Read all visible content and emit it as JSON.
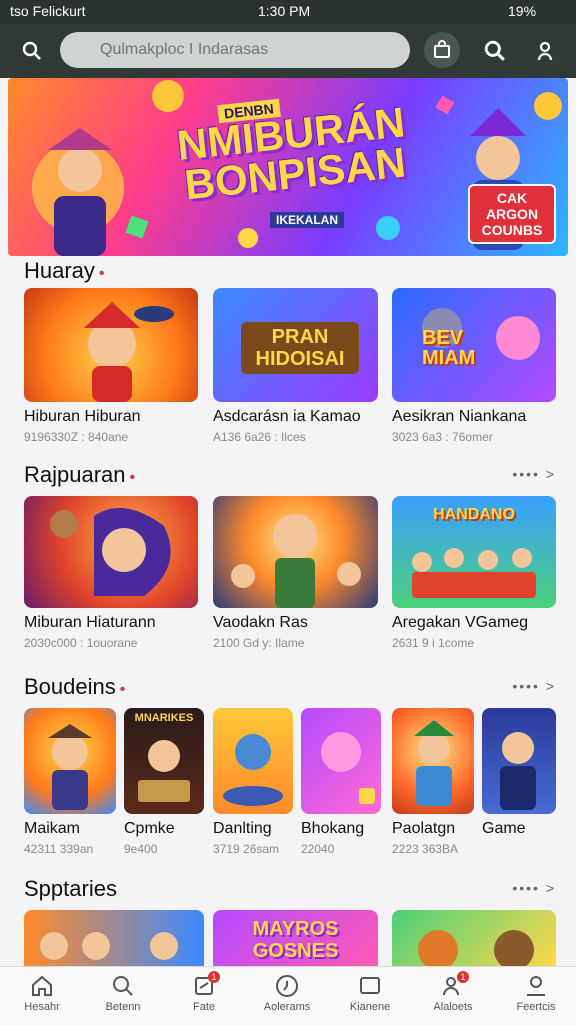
{
  "status_bar": {
    "carrier": "tso Felickurt",
    "time": "1:30 PM",
    "battery": "19%"
  },
  "header": {
    "search_placeholder": "Qulmakploc I Indarasas"
  },
  "banner": {
    "small_label": "DENBN",
    "title": "NMIBURÁN BONPISAN",
    "subtitle": "IKEKALAN",
    "tag": "CAK ARGON COUNBS"
  },
  "sections": [
    {
      "title": "Huaray",
      "more": "",
      "cards": [
        {
          "title": "Hiburan Hiburan",
          "meta": "9196330Z : 840ane",
          "thumb_text": ""
        },
        {
          "title": "Asdcarásn ia Kamao",
          "meta": "A136 6a26 : Ilces",
          "thumb_text": "PRAN HIDOISAI"
        },
        {
          "title": "Aesikran Niankana",
          "meta": "3023 6a3 : 76omer",
          "thumb_text": "BEV MIAM"
        }
      ]
    },
    {
      "title": "Rajpuaran",
      "more": "•••• >",
      "cards": [
        {
          "title": "Miburan Hiaturann",
          "meta": "2030c000 : 1ouorane",
          "thumb_text": ""
        },
        {
          "title": "Vaodakn Ras",
          "meta": "2100 Gd y: Ilame",
          "thumb_text": ""
        },
        {
          "title": "Aregakan VGameg",
          "meta": "2631 9 i 1come",
          "thumb_text": "HANDANO"
        }
      ]
    },
    {
      "title": "Boudeins",
      "more": "•••• >",
      "cards": [
        {
          "title": "Maikam",
          "meta": "42311 339an",
          "thumb_text": ""
        },
        {
          "title": "Cpmke",
          "meta": "9e400",
          "thumb_text": "MNARIKES"
        },
        {
          "title": "Danlting",
          "meta": "3719 26sam",
          "thumb_text": ""
        },
        {
          "title": "Bhokang",
          "meta": "22040",
          "thumb_text": ""
        },
        {
          "title": "Paolatgn",
          "meta": "2223 363BA",
          "thumb_text": ""
        },
        {
          "title": "Game",
          "meta": "",
          "thumb_text": ""
        }
      ]
    },
    {
      "title": "Spptaries",
      "more": "•••• >",
      "cards": [
        {
          "title": "",
          "meta": "",
          "thumb_text": ""
        },
        {
          "title": "",
          "meta": "",
          "thumb_text": "MAYROS GOSNES"
        },
        {
          "title": "",
          "meta": "",
          "thumb_text": ""
        }
      ]
    }
  ],
  "bottom_nav": [
    {
      "label": "Hesahr",
      "icon": "home-icon"
    },
    {
      "label": "Betenn",
      "icon": "search-icon"
    },
    {
      "label": "Fate",
      "icon": "tag-icon",
      "badge": "1"
    },
    {
      "label": "Aolerams",
      "icon": "clock-icon"
    },
    {
      "label": "Kianene",
      "icon": "square-icon"
    },
    {
      "label": "Alaloets",
      "icon": "people-icon",
      "badge": "1"
    },
    {
      "label": "Feertcis",
      "icon": "person-icon"
    }
  ],
  "colors": {
    "header": "#2f3a36",
    "accent": "#e03030",
    "background": "#f4f4f6"
  }
}
